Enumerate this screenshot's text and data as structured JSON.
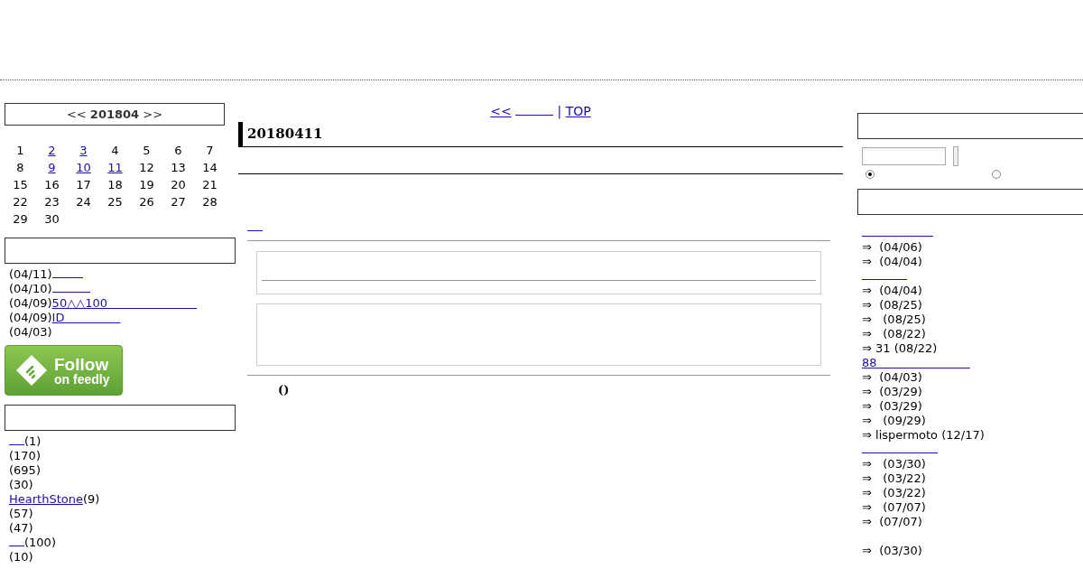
{
  "calendar": {
    "heading": "<< **201804** >>",
    "days": [
      {
        "label": "1",
        "linked": false
      },
      {
        "label": "2",
        "linked": true
      },
      {
        "label": "3",
        "linked": true
      },
      {
        "label": "4",
        "linked": false
      },
      {
        "label": "5",
        "linked": false
      },
      {
        "label": "6",
        "linked": false
      },
      {
        "label": "7",
        "linked": false
      },
      {
        "label": "8",
        "linked": false
      },
      {
        "label": "9",
        "linked": true
      },
      {
        "label": "10",
        "linked": true
      },
      {
        "label": "11",
        "linked": true
      },
      {
        "label": "12",
        "linked": false
      },
      {
        "label": "13",
        "linked": false
      },
      {
        "label": "14",
        "linked": false
      },
      {
        "label": "15",
        "linked": false
      },
      {
        "label": "16",
        "linked": false
      },
      {
        "label": "17",
        "linked": false
      },
      {
        "label": "18",
        "linked": false
      },
      {
        "label": "19",
        "linked": false
      },
      {
        "label": "20",
        "linked": false
      },
      {
        "label": "21",
        "linked": false
      },
      {
        "label": "22",
        "linked": false
      },
      {
        "label": "23",
        "linked": false
      },
      {
        "label": "24",
        "linked": false
      },
      {
        "label": "25",
        "linked": false
      },
      {
        "label": "26",
        "linked": false
      },
      {
        "label": "27",
        "linked": false
      },
      {
        "label": "28",
        "linked": false
      },
      {
        "label": "29",
        "linked": false
      },
      {
        "label": "30",
        "linked": false
      }
    ]
  },
  "recent_entries": [
    {
      "date": "(04/11)"
    },
    {
      "date": "(04/10)"
    },
    {
      "date": "(04/09)",
      "link": "50△△100                        "
    },
    {
      "date": "(04/09)",
      "link": "ID               "
    },
    {
      "date": "(04/03)"
    }
  ],
  "follow_button": {
    "title": "Follow",
    "subtitle": "on feedly"
  },
  "categories": [
    {
      "count": "(1)"
    },
    {
      "count": "(170)"
    },
    {
      "count": "(695)"
    },
    {
      "count": "(30)"
    },
    {
      "link": "HearthStone",
      "count": "(9)"
    },
    {
      "count": "(57)"
    },
    {
      "count": "(47)"
    },
    {
      "count": "(100)"
    },
    {
      "count": "(10)"
    }
  ],
  "nav": {
    "prev": "<<",
    "separator": "|",
    "top": "TOP"
  },
  "entry": {
    "title": "20180411",
    "footer": "()"
  },
  "search": {
    "options": [
      {
        "selected": true
      },
      {
        "selected": false
      }
    ]
  },
  "comment_groups": [
    {
      "items": [
        "⇒  (04/06)",
        "⇒  (04/04)"
      ]
    },
    {
      "items": [
        "⇒  (04/04)",
        "⇒  (08/25)",
        "⇒   (08/25)",
        "⇒   (08/22)",
        "⇒ 31 (08/22)"
      ]
    },
    {
      "title": "88                         ",
      "items": [
        "⇒  (04/03)",
        "⇒  (03/29)",
        "⇒  (03/29)",
        "⇒   (09/29)",
        "⇒ lispermoto (12/17)"
      ]
    },
    {
      "items": [
        "⇒   (03/30)",
        "⇒   (03/22)",
        "⇒   (03/22)",
        "⇒   (07/07)",
        "⇒  (07/07)"
      ]
    },
    {
      "items": [
        "⇒  (03/30)"
      ]
    }
  ]
}
